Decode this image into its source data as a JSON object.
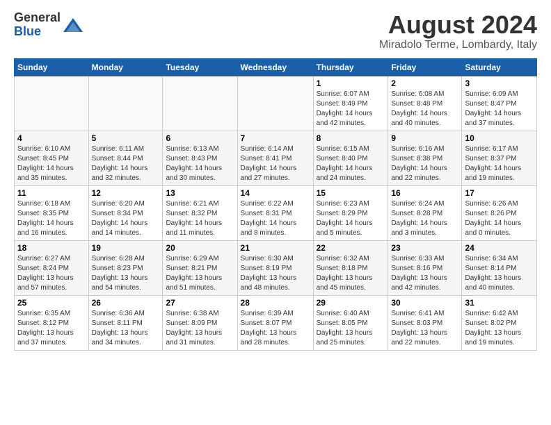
{
  "logo": {
    "general": "General",
    "blue": "Blue"
  },
  "title": "August 2024",
  "subtitle": "Miradolo Terme, Lombardy, Italy",
  "days_of_week": [
    "Sunday",
    "Monday",
    "Tuesday",
    "Wednesday",
    "Thursday",
    "Friday",
    "Saturday"
  ],
  "weeks": [
    [
      {
        "day": "",
        "info": ""
      },
      {
        "day": "",
        "info": ""
      },
      {
        "day": "",
        "info": ""
      },
      {
        "day": "",
        "info": ""
      },
      {
        "day": "1",
        "info": "Sunrise: 6:07 AM\nSunset: 8:49 PM\nDaylight: 14 hours\nand 42 minutes."
      },
      {
        "day": "2",
        "info": "Sunrise: 6:08 AM\nSunset: 8:48 PM\nDaylight: 14 hours\nand 40 minutes."
      },
      {
        "day": "3",
        "info": "Sunrise: 6:09 AM\nSunset: 8:47 PM\nDaylight: 14 hours\nand 37 minutes."
      }
    ],
    [
      {
        "day": "4",
        "info": "Sunrise: 6:10 AM\nSunset: 8:45 PM\nDaylight: 14 hours\nand 35 minutes."
      },
      {
        "day": "5",
        "info": "Sunrise: 6:11 AM\nSunset: 8:44 PM\nDaylight: 14 hours\nand 32 minutes."
      },
      {
        "day": "6",
        "info": "Sunrise: 6:13 AM\nSunset: 8:43 PM\nDaylight: 14 hours\nand 30 minutes."
      },
      {
        "day": "7",
        "info": "Sunrise: 6:14 AM\nSunset: 8:41 PM\nDaylight: 14 hours\nand 27 minutes."
      },
      {
        "day": "8",
        "info": "Sunrise: 6:15 AM\nSunset: 8:40 PM\nDaylight: 14 hours\nand 24 minutes."
      },
      {
        "day": "9",
        "info": "Sunrise: 6:16 AM\nSunset: 8:38 PM\nDaylight: 14 hours\nand 22 minutes."
      },
      {
        "day": "10",
        "info": "Sunrise: 6:17 AM\nSunset: 8:37 PM\nDaylight: 14 hours\nand 19 minutes."
      }
    ],
    [
      {
        "day": "11",
        "info": "Sunrise: 6:18 AM\nSunset: 8:35 PM\nDaylight: 14 hours\nand 16 minutes."
      },
      {
        "day": "12",
        "info": "Sunrise: 6:20 AM\nSunset: 8:34 PM\nDaylight: 14 hours\nand 14 minutes."
      },
      {
        "day": "13",
        "info": "Sunrise: 6:21 AM\nSunset: 8:32 PM\nDaylight: 14 hours\nand 11 minutes."
      },
      {
        "day": "14",
        "info": "Sunrise: 6:22 AM\nSunset: 8:31 PM\nDaylight: 14 hours\nand 8 minutes."
      },
      {
        "day": "15",
        "info": "Sunrise: 6:23 AM\nSunset: 8:29 PM\nDaylight: 14 hours\nand 5 minutes."
      },
      {
        "day": "16",
        "info": "Sunrise: 6:24 AM\nSunset: 8:28 PM\nDaylight: 14 hours\nand 3 minutes."
      },
      {
        "day": "17",
        "info": "Sunrise: 6:26 AM\nSunset: 8:26 PM\nDaylight: 14 hours\nand 0 minutes."
      }
    ],
    [
      {
        "day": "18",
        "info": "Sunrise: 6:27 AM\nSunset: 8:24 PM\nDaylight: 13 hours\nand 57 minutes."
      },
      {
        "day": "19",
        "info": "Sunrise: 6:28 AM\nSunset: 8:23 PM\nDaylight: 13 hours\nand 54 minutes."
      },
      {
        "day": "20",
        "info": "Sunrise: 6:29 AM\nSunset: 8:21 PM\nDaylight: 13 hours\nand 51 minutes."
      },
      {
        "day": "21",
        "info": "Sunrise: 6:30 AM\nSunset: 8:19 PM\nDaylight: 13 hours\nand 48 minutes."
      },
      {
        "day": "22",
        "info": "Sunrise: 6:32 AM\nSunset: 8:18 PM\nDaylight: 13 hours\nand 45 minutes."
      },
      {
        "day": "23",
        "info": "Sunrise: 6:33 AM\nSunset: 8:16 PM\nDaylight: 13 hours\nand 42 minutes."
      },
      {
        "day": "24",
        "info": "Sunrise: 6:34 AM\nSunset: 8:14 PM\nDaylight: 13 hours\nand 40 minutes."
      }
    ],
    [
      {
        "day": "25",
        "info": "Sunrise: 6:35 AM\nSunset: 8:12 PM\nDaylight: 13 hours\nand 37 minutes."
      },
      {
        "day": "26",
        "info": "Sunrise: 6:36 AM\nSunset: 8:11 PM\nDaylight: 13 hours\nand 34 minutes."
      },
      {
        "day": "27",
        "info": "Sunrise: 6:38 AM\nSunset: 8:09 PM\nDaylight: 13 hours\nand 31 minutes."
      },
      {
        "day": "28",
        "info": "Sunrise: 6:39 AM\nSunset: 8:07 PM\nDaylight: 13 hours\nand 28 minutes."
      },
      {
        "day": "29",
        "info": "Sunrise: 6:40 AM\nSunset: 8:05 PM\nDaylight: 13 hours\nand 25 minutes."
      },
      {
        "day": "30",
        "info": "Sunrise: 6:41 AM\nSunset: 8:03 PM\nDaylight: 13 hours\nand 22 minutes."
      },
      {
        "day": "31",
        "info": "Sunrise: 6:42 AM\nSunset: 8:02 PM\nDaylight: 13 hours\nand 19 minutes."
      }
    ]
  ]
}
